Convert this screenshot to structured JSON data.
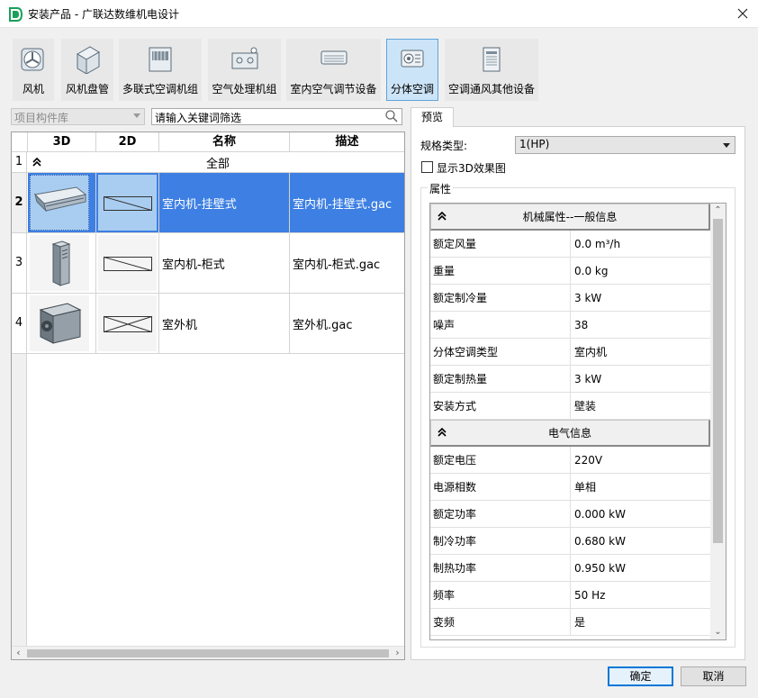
{
  "window": {
    "title": "安装产品 - 广联达数维机电设计"
  },
  "toolbar": {
    "buttons": [
      {
        "label": "风机",
        "icon": "fan-icon"
      },
      {
        "label": "风机盘管",
        "icon": "fan-coil-icon"
      },
      {
        "label": "多联式空调机组",
        "icon": "vrf-unit-icon"
      },
      {
        "label": "空气处理机组",
        "icon": "air-handler-icon"
      },
      {
        "label": "室内空气调节设备",
        "icon": "indoor-ac-icon"
      },
      {
        "label": "分体空调",
        "icon": "split-ac-icon",
        "active": true
      },
      {
        "label": "空调通风其他设备",
        "icon": "other-hvac-icon"
      }
    ]
  },
  "library": {
    "selected": "项目构件库",
    "search_placeholder": "请输入关键词筛选"
  },
  "grid": {
    "headers": {
      "col_3d": "3D",
      "col_2d": "2D",
      "col_name": "名称",
      "col_desc": "描述"
    },
    "group": {
      "row": "1",
      "label": "全部"
    },
    "rows": [
      {
        "num": "2",
        "name": "室内机-挂壁式",
        "desc": "室内机-挂壁式.gac",
        "selected": true
      },
      {
        "num": "3",
        "name": "室内机-柜式",
        "desc": "室内机-柜式.gac"
      },
      {
        "num": "4",
        "name": "室外机",
        "desc": "室外机.gac"
      }
    ]
  },
  "preview": {
    "tab_label": "预览",
    "spec_label": "规格类型:",
    "spec_value": "1(HP)",
    "show3d_label": "显示3D效果图",
    "show3d_checked": false,
    "props_group_title": "属性"
  },
  "properties": {
    "section1": "机械属性--一般信息",
    "mech": [
      {
        "k": "额定风量",
        "v": "0.0 m³/h"
      },
      {
        "k": "重量",
        "v": "0.0 kg"
      },
      {
        "k": "额定制冷量",
        "v": "3 kW"
      },
      {
        "k": "噪声",
        "v": "38"
      },
      {
        "k": "分体空调类型",
        "v": "室内机"
      },
      {
        "k": "额定制热量",
        "v": "3 kW"
      },
      {
        "k": "安装方式",
        "v": "壁装"
      }
    ],
    "section2": "电气信息",
    "elec": [
      {
        "k": "额定电压",
        "v": "220V"
      },
      {
        "k": "电源相数",
        "v": "单相"
      },
      {
        "k": "额定功率",
        "v": "0.000 kW"
      },
      {
        "k": "制冷功率",
        "v": "0.680 kW"
      },
      {
        "k": "制热功率",
        "v": "0.950 kW"
      },
      {
        "k": "频率",
        "v": "50 Hz"
      },
      {
        "k": "变频",
        "v": "是"
      }
    ]
  },
  "actions": {
    "ok": "确定",
    "cancel": "取消"
  },
  "colors": {
    "selection": "#3d7fe3",
    "active_tool_bg": "#cce4f7",
    "active_tool_border": "#5fa4dc"
  }
}
